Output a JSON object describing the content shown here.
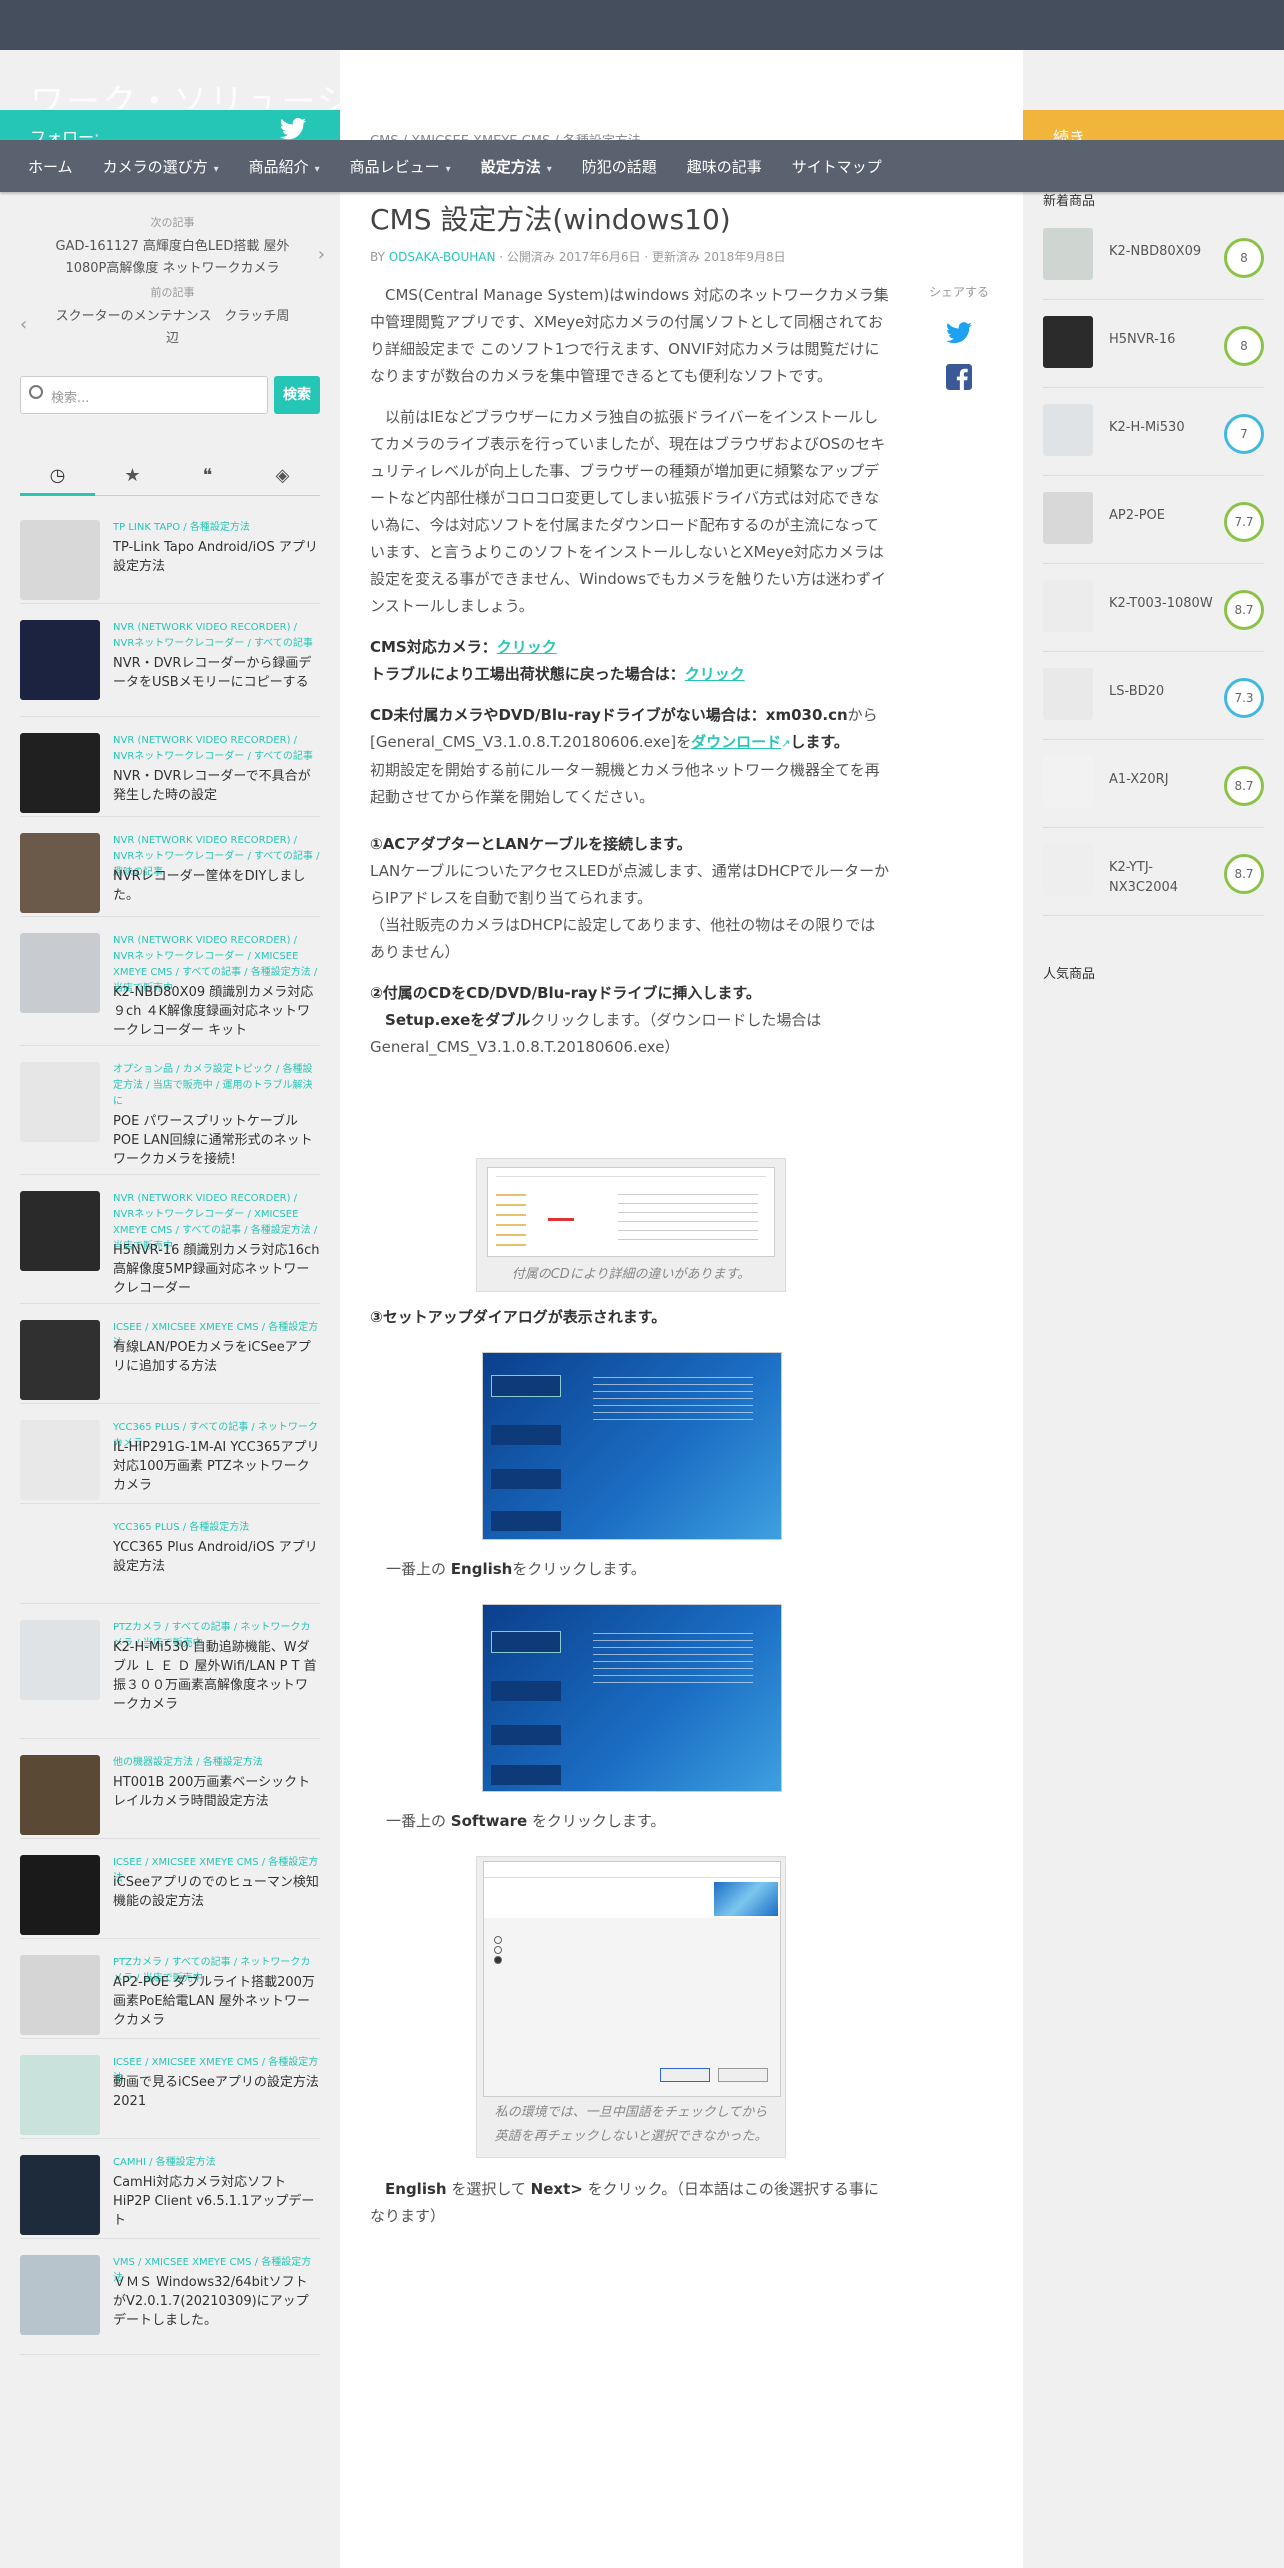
{
  "site": {
    "title": "ワーク・ソリューション"
  },
  "left_header": {
    "label": "フォロー:"
  },
  "right_header": {
    "label": "続き"
  },
  "nav": [
    {
      "label": "ホーム",
      "caret": false,
      "active": false
    },
    {
      "label": "カメラの選び方",
      "caret": true,
      "active": false
    },
    {
      "label": "商品紹介",
      "caret": true,
      "active": false
    },
    {
      "label": "商品レビュー",
      "caret": true,
      "active": false
    },
    {
      "label": "設定方法",
      "caret": true,
      "active": true
    },
    {
      "label": "防犯の話題",
      "caret": false,
      "active": false
    },
    {
      "label": "趣味の記事",
      "caret": false,
      "active": false
    },
    {
      "label": "サイトマップ",
      "caret": false,
      "active": false
    }
  ],
  "breadcrumb": "CMS / XMICSEE XMEYE CMS / 各種設定方法",
  "postnav": {
    "next_label": "次の記事",
    "next_title": "GAD-161127 高輝度白色LED搭載 屋外1080P高解像度 ネットワークカメラ",
    "prev_label": "前の記事",
    "prev_title": "スクーターのメンテナンス　クラッチ周辺"
  },
  "search": {
    "placeholder": "検索...",
    "button": "検索"
  },
  "sidebar_tabs": [
    {
      "icon": "clock-icon",
      "glyph": "◷"
    },
    {
      "icon": "star-icon",
      "glyph": "★"
    },
    {
      "icon": "comments-icon",
      "glyph": "❝"
    },
    {
      "icon": "tags-icon",
      "glyph": "◈"
    }
  ],
  "recent_posts": [
    {
      "cats": "TP LINK TAPO / 各種設定方法",
      "title": "TP-Link Tapo Android/iOS アプリ設定方法",
      "thumb": "#d8d8d8"
    },
    {
      "cats": "NVR (NETWORK VIDEO RECORDER) / NVRネットワークレコーダー / すべての記事",
      "title": "NVR・DVRレコーダーから録画データをUSBメモリーにコピーする",
      "thumb": "#1c2340"
    },
    {
      "cats": "NVR (NETWORK VIDEO RECORDER) / NVRネットワークレコーダー / すべての記事",
      "title": "NVR・DVRレコーダーで不具合が発生した時の設定",
      "thumb": "#202020"
    },
    {
      "cats": "NVR (NETWORK VIDEO RECORDER) / NVRネットワークレコーダー / すべての記事 / 趣味の記事",
      "title": "NVRレコーダー筐体をDIYしました。",
      "thumb": "#6b5a4a"
    },
    {
      "cats": "NVR (NETWORK VIDEO RECORDER) / NVRネットワークレコーダー / XMICSEE XMEYE CMS / すべての記事 / 各種設定方法 / 当店で販売中",
      "title": "K2-NBD80X09 顔識別カメラ対応９ch ４K解像度録画対応ネットワークレコーダー キット",
      "thumb": "#c8ccd0"
    },
    {
      "cats": "オプション品 / カメラ設定トピック / 各種設定方法 / 当店で販売中 / 運用のトラブル解決に",
      "title": "POE パワースプリットケーブル POE LAN回線に通常形式のネットワークカメラを接続！",
      "thumb": "#e6e6e6"
    },
    {
      "cats": "NVR (NETWORK VIDEO RECORDER) / NVRネットワークレコーダー / XMICSEE XMEYE CMS / すべての記事 / 各種設定方法 / 当店で販売中",
      "title": "H5NVR-16 顔識別カメラ対応16ch高解像度5MP録画対応ネットワークレコーダー",
      "thumb": "#2a2a2a"
    },
    {
      "cats": "ICSEE / XMICSEE XMEYE CMS / 各種設定方法",
      "title": "有線LAN/POEカメラをiCSeeアプリに追加する方法",
      "thumb": "#303030"
    },
    {
      "cats": "YCC365 PLUS / すべての記事 / ネットワークカメラ",
      "title": "IL-HIP291G-1M-AI YCC365アプリ対応100万画素 PTZネットワークカメラ",
      "thumb": "#e8e8e8"
    },
    {
      "cats": "YCC365 PLUS / 各種設定方法",
      "title": "YCC365 Plus Android/iOS アプリ設定方法",
      "thumb": "#f0f0f0"
    },
    {
      "cats": "PTZカメラ / すべての記事 / ネットワークカメラ / 当店で販売中",
      "title": "K2-H-Mi530 自動追跡機能、Wダブル Ｌ Ｅ Ｄ 屋外Wifi/LAN P T 首振３００万画素高解像度ネットワークカメラ",
      "thumb": "#dfe3e6"
    },
    {
      "cats": "他の機器設定方法 / 各種設定方法",
      "title": "HT001B 200万画素ベーシックトレイルカメラ時間設定方法",
      "thumb": "#5a4a35"
    },
    {
      "cats": "ICSEE / XMICSEE XMEYE CMS / 各種設定方法",
      "title": "iCSeeアプリのでのヒューマン検知機能の設定方法",
      "thumb": "#1a1a1a"
    },
    {
      "cats": "PTZカメラ / すべての記事 / ネットワークカメラ / 当店で販売中",
      "title": "AP2-POE ダブルライト搭載200万画素PoE給電LAN 屋外ネットワークカメラ",
      "thumb": "#d5d5d5"
    },
    {
      "cats": "ICSEE / XMICSEE XMEYE CMS / 各種設定方法",
      "title": "動画で見るiCSeeアプリの設定方法2021",
      "thumb": "#c9e3dc"
    },
    {
      "cats": "CAMHI / 各種設定方法",
      "title": "CamHi対応カメラ対応ソフト HiP2P Client v6.5.1.1アップデート",
      "thumb": "#1d2b3a"
    },
    {
      "cats": "VMS / XMICSEE XMEYE CMS / 各種設定方法",
      "title": "ＶＭＳ Windows32/64bitソフトがV2.0.1.7(20210309)にアップデートしました。",
      "thumb": "#b8c4cc"
    }
  ],
  "article": {
    "title": "CMS 設定方法(windows10)",
    "by": "BY",
    "author": "ODSAKA-BOUHAN",
    "dates": "· 公開済み 2017年6月6日 · 更新済み 2018年9月8日",
    "p1": "　CMS(Central Manage System)はwindows 対応のネットワークカメラ集中管理閲覧アプリです、XMeye対応カメラの付属ソフトとして同梱されており詳細設定まで このソフト1つで行えます、ONVIF対応カメラは閲覧だけになりますが数台のカメラを集中管理できるとても便利なソフトです。",
    "p2": "　以前はIEなどブラウザーにカメラ独自の拡張ドライバーをインストールしてカメラのライブ表示を行っていましたが、現在はブラウザおよびOSのセキュリティレベルが向上した事、ブラウザーの種類が増加更に頻繁なアップデートなど内部仕様がコロコロ変更してしまい拡張ドライバ方式は対応できない為に、今は対応ソフトを付属またダウンロード配布するのが主流になっています、と言うよりこのソフトをインストールしないとXMeye対応カメラは設定を変える事ができません、Windowsでもカメラを触りたい方は迷わずインストールしましょう。",
    "cms_label": "CMS対応カメラ：",
    "cms_link": "クリック",
    "reset_label": "トラブルにより工場出荷状態に戻った場合は：",
    "reset_link": "クリック",
    "cd_label": "CD未付属カメラやDVD/Blu-rayドライブがない場合は：xm030.cn",
    "cd_text": "から[General_CMS_V3.1.0.8.T.20180606.exe]を",
    "cd_link": "ダウンロード",
    "cd_end": "します。",
    "init": "初期設定を開始する前にルーター親機とカメラ他ネットワーク機器全てを再起動させてから作業を開始してください。",
    "s1_head": "①ACアダプターとLANケーブルを接続します。",
    "s1_text": "LANケーブルについたアクセスLEDが点滅します、通常はDHCPでルーターからIPアドレスを自動で割り当てられます。",
    "s1_note": "（当社販売のカメラはDHCPに設定してあります、他社の物はその限りではありません）",
    "s2_head": "②付属のCDをCD/DVD/Blu-rayドライブに挿入します。",
    "s2_bold": "Setup.exeをダブル",
    "s2_text": "クリックします。（ダウンロードした場合はGeneral_CMS_V3.1.0.8.T.20180606.exe）",
    "fig1_cap": "付属のCDにより詳細の違いがあります。",
    "s3_head": "③セットアップダイアログが表示されます。",
    "s3_a1": "一番上の ",
    "s3_a2": "English",
    "s3_a3": "をクリックします。",
    "s3_b1": "一番上の ",
    "s3_b2": "Software",
    "s3_b3": " をクリックします。",
    "fig4_cap": "私の環境では、一旦中国語をチェックしてから英語を再チェックしないと選択できなかった。",
    "s3_c1": "English",
    "s3_c2": " を選択して ",
    "s3_c3": "Next>",
    "s3_c4": " をクリック。（日本語はこの後選択する事になります）"
  },
  "share": {
    "label": "シェアする"
  },
  "new_products": {
    "title": "新着商品",
    "items": [
      {
        "name": "K2-NBD80X09",
        "score": "8",
        "thumb": "#cfd6d2",
        "style": "g"
      },
      {
        "name": "H5NVR-16",
        "score": "8",
        "thumb": "#2b2b2b",
        "style": "g"
      },
      {
        "name": "K2-H-Mi530",
        "score": "7",
        "thumb": "#e0e3e6",
        "style": "b"
      },
      {
        "name": "AP2-POE",
        "score": "7.7",
        "thumb": "#d8d8d8",
        "style": "g"
      },
      {
        "name": "K2-T003-1080W",
        "score": "8.7",
        "thumb": "#ececec",
        "style": "g"
      },
      {
        "name": "LS-BD20",
        "score": "7.3",
        "thumb": "#e9e9e9",
        "style": "b"
      },
      {
        "name": "A1-X20RJ",
        "score": "8.7",
        "thumb": "#f2f2f2",
        "style": "g"
      },
      {
        "name": "K2-YTJ-NX3C2004",
        "score": "8.7",
        "thumb": "#eeeeee",
        "style": "g"
      }
    ]
  },
  "popular": {
    "title": "人気商品"
  },
  "colors": {
    "accent": "#26c6b6",
    "nav": "#5a6270",
    "topbar": "#454e5c",
    "orange": "#f1b53c"
  }
}
